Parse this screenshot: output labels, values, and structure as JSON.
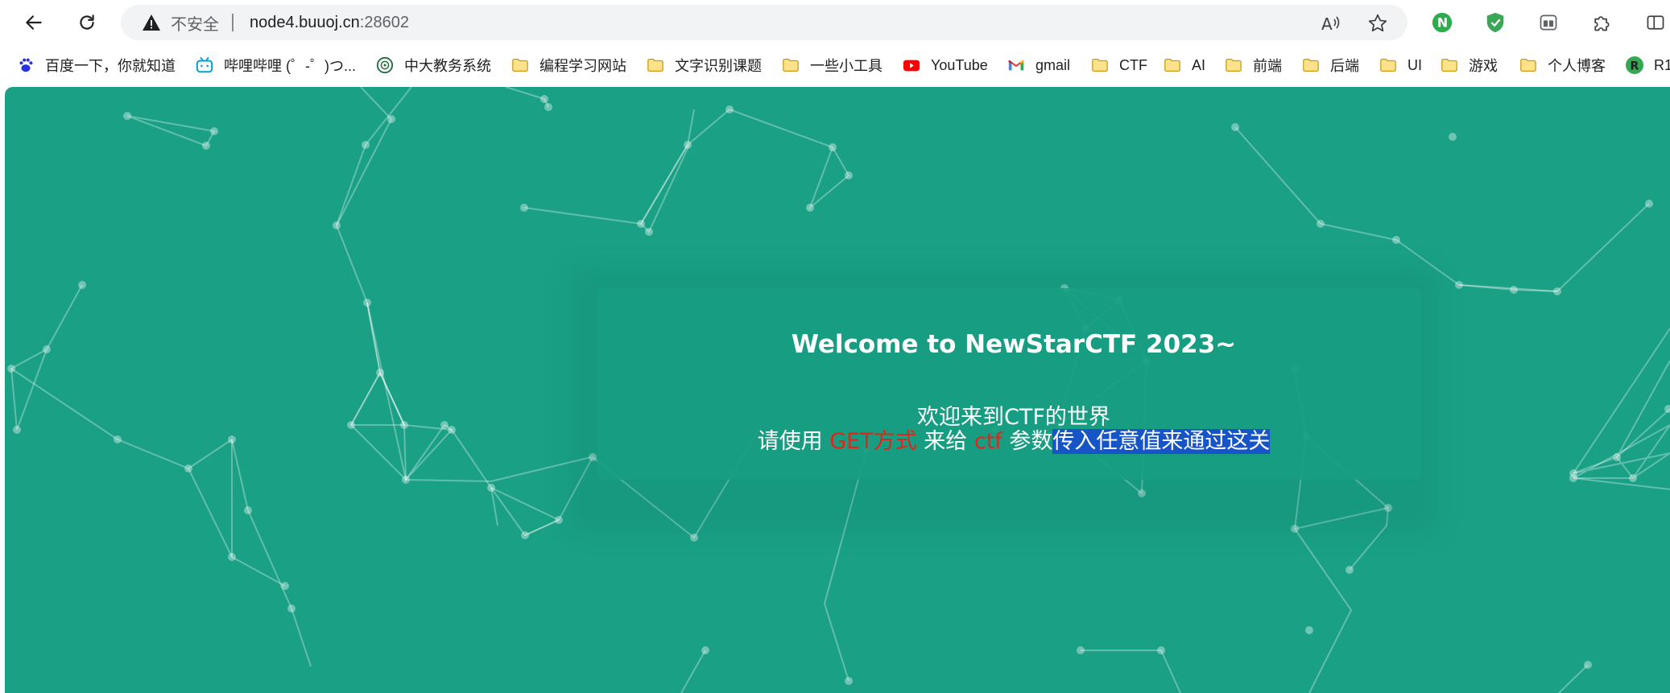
{
  "browser": {
    "address_bar": {
      "security_label": "不安全",
      "url_host": "node4.buuoj.cn",
      "url_port": ":28602"
    },
    "icons": {
      "back": "back-arrow-icon",
      "reload": "reload-icon",
      "read_aloud": "read-aloud-icon",
      "favorite": "star-icon"
    },
    "extensions": [
      {
        "name": "n-extension-icon",
        "color": "#2dab4f"
      },
      {
        "name": "shield-extension-icon",
        "color": "#3aa757"
      },
      {
        "name": "tab-manager-icon",
        "color": "#5f6368"
      },
      {
        "name": "puzzle-extensions-icon",
        "color": "#3c4043"
      },
      {
        "name": "split-screen-icon",
        "color": "#3c4043"
      }
    ]
  },
  "bookmarks": [
    {
      "label": "百度一下，你就知道",
      "icon": "baidu-icon"
    },
    {
      "label": "哔哩哔哩 (゜-゜)つ...",
      "icon": "bilibili-icon"
    },
    {
      "label": "中大教务系统",
      "icon": "university-seal-icon"
    },
    {
      "label": "编程学习网站",
      "icon": "folder-icon"
    },
    {
      "label": "文字识别课题",
      "icon": "folder-icon"
    },
    {
      "label": "一些小工具",
      "icon": "folder-icon"
    },
    {
      "label": "YouTube",
      "icon": "youtube-icon"
    },
    {
      "label": "gmail",
      "icon": "gmail-icon"
    },
    {
      "label": "CTF",
      "icon": "folder-icon"
    },
    {
      "label": "AI",
      "icon": "folder-icon"
    },
    {
      "label": "前端",
      "icon": "folder-icon"
    },
    {
      "label": "后端",
      "icon": "folder-icon"
    },
    {
      "label": "UI",
      "icon": "folder-icon"
    },
    {
      "label": "游戏",
      "icon": "folder-icon"
    },
    {
      "label": "个人博客",
      "icon": "folder-icon"
    },
    {
      "label": "R1",
      "icon": "r-avatar-icon"
    }
  ],
  "page": {
    "title": "Welcome to NewStarCTF 2023~",
    "subtitle": "欢迎来到CTF的世界",
    "instruction": {
      "part1": "请使用 ",
      "part2": "GET方式",
      "part3": " 来给 ",
      "part4": "ctf",
      "part5": " 参数",
      "part6": "传入任意值来通过这关"
    }
  },
  "colors": {
    "page_background": "#19a085",
    "accent_red": "#e0261a",
    "selection": "#1654c8"
  }
}
